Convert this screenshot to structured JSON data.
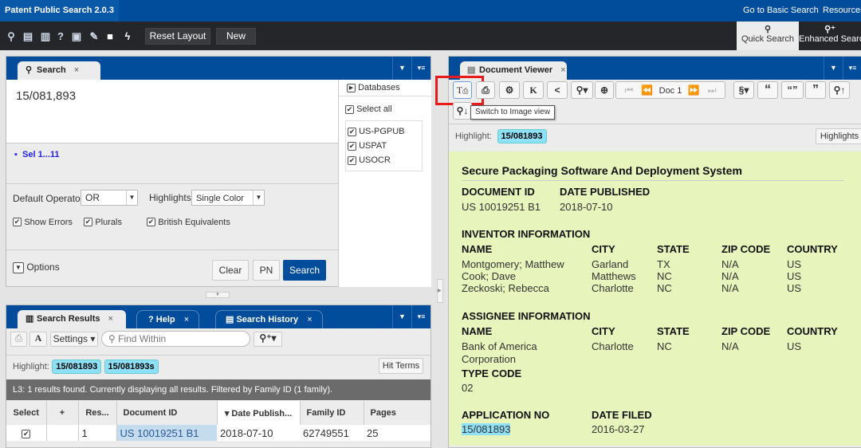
{
  "app": {
    "title": "Patent Public Search 2.0.3",
    "links": [
      "Go to Basic Search",
      "Resources"
    ]
  },
  "toolbar": {
    "reset_layout": "Reset Layout",
    "new": "New",
    "quick_search": "Quick Search",
    "enhanced_search": "Enhanced Search"
  },
  "search_panel": {
    "tab": "Search",
    "query": "15/081,893",
    "history_item": "Sel 1...11",
    "databases_label": "Databases",
    "select_all": "Select all",
    "databases": [
      "US-PGPUB",
      "USPAT",
      "USOCR"
    ],
    "default_operator_label": "Default Operator:",
    "default_operator": "OR",
    "highlights_label": "Highlights:",
    "highlights": "Single Color",
    "show_errors": "Show Errors",
    "plurals": "Plurals",
    "british": "British Equivalents",
    "options": "Options",
    "clear": "Clear",
    "pn": "PN",
    "search": "Search"
  },
  "results_panel": {
    "tabs": [
      "Search Results",
      "Help",
      "Search History"
    ],
    "settings": "Settings",
    "find_placeholder": "Find Within",
    "highlight_label": "Highlight:",
    "highlights": [
      "15/081893",
      "15/081893s"
    ],
    "hit_terms": "Hit Terms",
    "status": "L3:  1 results found. Currently displaying all results. Filtered by Family ID (1 family).",
    "columns": [
      "Select",
      "+",
      "Res...",
      "Document ID",
      "▾ Date Publish...",
      "Family ID",
      "Pages"
    ],
    "rows": [
      {
        "res": "1",
        "doc_id": "US 10019251 B1",
        "date": "2018-07-10",
        "family": "62749551",
        "pages": "25"
      }
    ]
  },
  "viewer": {
    "tab": "Document Viewer",
    "doc_nav": "Doc 1",
    "tooltip": "Switch to Image view",
    "highlight_label": "Highlight:",
    "highlight": "15/081893",
    "highlights_btn": "Highlights",
    "title": "Secure Packaging Software And Deployment System",
    "doc_id_label": "DOCUMENT ID",
    "doc_id": "US 10019251 B1",
    "date_pub_label": "DATE PUBLISHED",
    "date_pub": "2018-07-10",
    "inventor_heading": "INVENTOR INFORMATION",
    "cols": [
      "NAME",
      "CITY",
      "STATE",
      "ZIP CODE",
      "COUNTRY"
    ],
    "inventors": [
      [
        "Montgomery; Matthew",
        "Garland",
        "TX",
        "N/A",
        "US"
      ],
      [
        "Cook; Dave",
        "Matthews",
        "NC",
        "N/A",
        "US"
      ],
      [
        "Zeckoski; Rebecca",
        "Charlotte",
        "NC",
        "N/A",
        "US"
      ]
    ],
    "assignee_heading": "ASSIGNEE INFORMATION",
    "assignee": [
      "Bank of America Corporation",
      "Charlotte",
      "NC",
      "N/A",
      "US"
    ],
    "type_code_label": "TYPE CODE",
    "type_code": "02",
    "app_no_label": "APPLICATION NO",
    "app_no": "15/081893",
    "date_filed_label": "DATE FILED",
    "date_filed": "2016-03-27"
  }
}
